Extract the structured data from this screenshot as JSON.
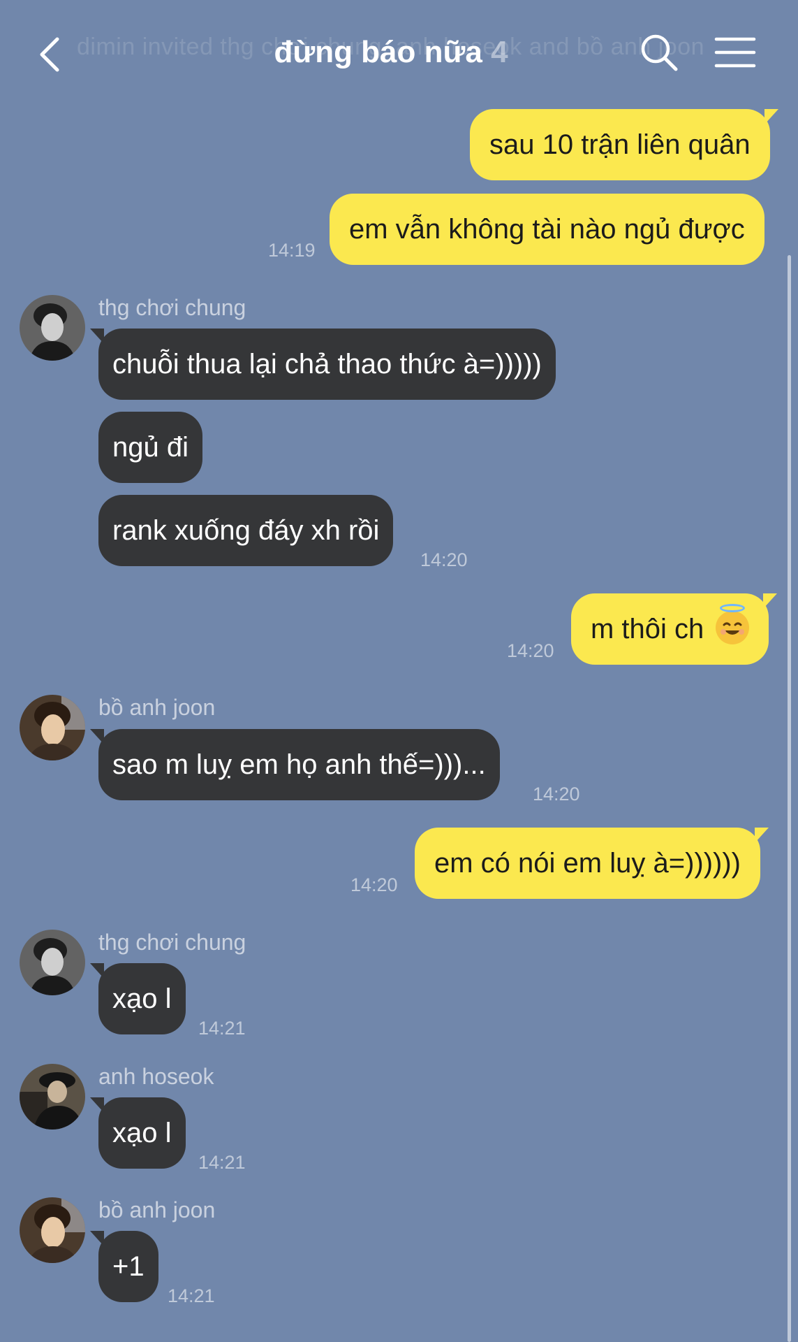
{
  "header": {
    "ghost_text": "dimin invited thg chơi chung, anh hoseok and bồ anh joon",
    "title": "đừng báo nữa",
    "member_count": "4",
    "icons": {
      "back": "chevron-left-icon",
      "search": "search-icon",
      "menu": "hamburger-menu-icon"
    }
  },
  "colors": {
    "background": "#7187ab",
    "my_bubble": "#fbe84f",
    "other_bubble": "#353638"
  },
  "messages": {
    "m1": {
      "text": "sau 10 trận liên quân"
    },
    "m2": {
      "text": "em vẫn không tài nào ngủ được",
      "time": "14:19"
    },
    "g1": {
      "sender": "thg chơi chung",
      "b1": "chuỗi thua lại chả thao thức à=)))))",
      "b2": "ngủ đi",
      "b3": "rank xuống đáy xh rồi",
      "time": "14:20"
    },
    "m3": {
      "text": "m thôi ch",
      "emoji": "smiling-face-with-halo",
      "time": "14:20"
    },
    "g2": {
      "sender": "bồ anh joon",
      "b1": "sao m luỵ em họ anh thế=)))...",
      "time": "14:20"
    },
    "m4": {
      "text": "em có nói em luỵ à=))))))",
      "time": "14:20"
    },
    "g3": {
      "sender": "thg chơi chung",
      "b1": "xạo l",
      "time": "14:21"
    },
    "g4": {
      "sender": "anh hoseok",
      "b1": "xạo l",
      "time": "14:21"
    },
    "g5": {
      "sender": "bồ anh joon",
      "b1": "+1",
      "time": "14:21"
    }
  }
}
